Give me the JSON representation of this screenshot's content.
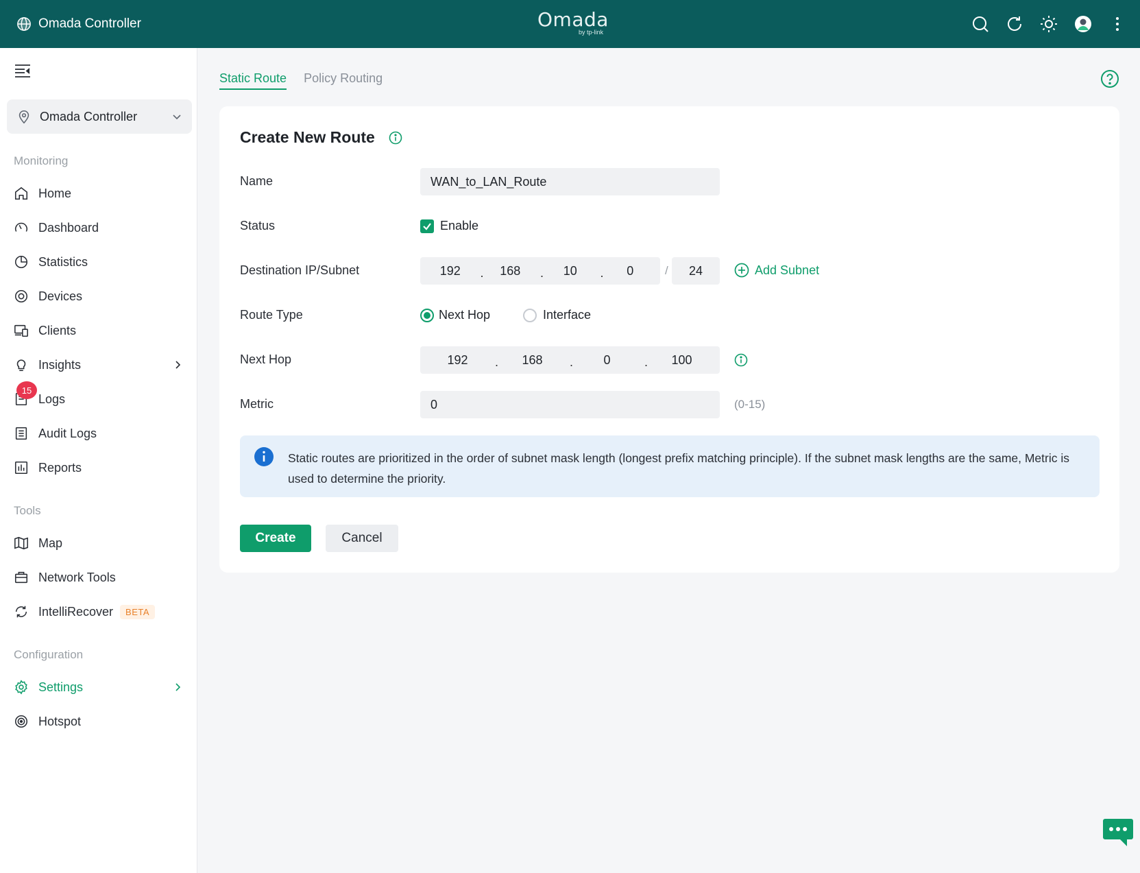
{
  "app": {
    "brand": "Omada Controller",
    "logo_main": "Omada",
    "logo_sub": "by tp-link"
  },
  "topbar_icons": [
    "search-icon",
    "refresh-icon",
    "theme-icon",
    "avatar",
    "more-icon"
  ],
  "sidebar": {
    "site": "Omada Controller",
    "sections": {
      "monitoring": "Monitoring",
      "tools": "Tools",
      "configuration": "Configuration"
    },
    "items": {
      "home": "Home",
      "dashboard": "Dashboard",
      "statistics": "Statistics",
      "devices": "Devices",
      "clients": "Clients",
      "insights": "Insights",
      "logs": "Logs",
      "logs_badge": "15",
      "audit_logs": "Audit Logs",
      "reports": "Reports",
      "map": "Map",
      "network_tools": "Network Tools",
      "intellirecover": "IntelliRecover",
      "beta": "BETA",
      "settings": "Settings",
      "hotspot": "Hotspot"
    }
  },
  "tabs": {
    "static_route": "Static Route",
    "policy_routing": "Policy Routing"
  },
  "form": {
    "title": "Create New Route",
    "labels": {
      "name": "Name",
      "status": "Status",
      "destination": "Destination IP/Subnet",
      "route_type": "Route Type",
      "next_hop": "Next Hop",
      "metric": "Metric"
    },
    "name_value": "WAN_to_LAN_Route",
    "status_enabled": true,
    "status_label": "Enable",
    "destination_ip": [
      "192",
      "168",
      "10",
      "0"
    ],
    "subnet_mask": "24",
    "ip_separator": ".",
    "mask_separator": "/",
    "add_subnet": "Add Subnet",
    "route_type_options": {
      "next_hop": "Next Hop",
      "interface": "Interface"
    },
    "route_type_selected": "Next Hop",
    "next_hop_ip": [
      "192",
      "168",
      "0",
      "100"
    ],
    "metric_value": "0",
    "metric_hint": "(0-15)",
    "info_text": "Static routes are prioritized in the order of subnet mask length (longest prefix matching principle). If the subnet mask lengths are the same, Metric is used to determine the priority.",
    "create_label": "Create",
    "cancel_label": "Cancel"
  },
  "colors": {
    "topbar": "#0b5c5c",
    "accent": "#0f9d6b",
    "badge": "#e8364f",
    "info_bg": "#e6f0fa",
    "info_icon": "#1a6fd1"
  }
}
